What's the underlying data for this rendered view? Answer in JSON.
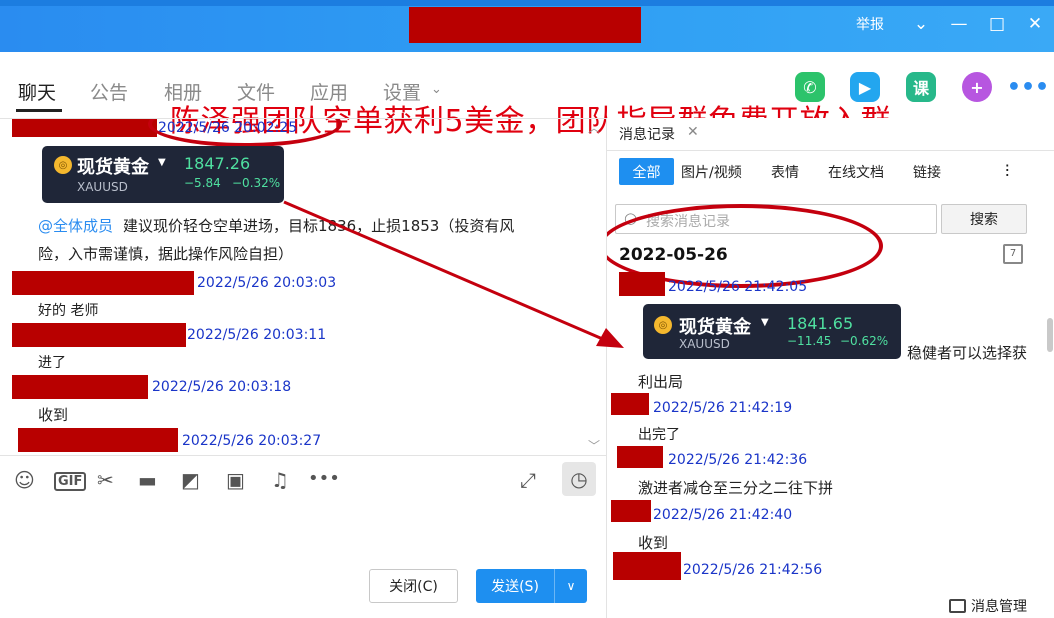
{
  "titlebar": {
    "report": "举报",
    "min": "—",
    "max": "□",
    "close": "✕",
    "dropdown": "⌄"
  },
  "banner": "陈泽强团队空单获利5美金，团队指导群免费开放入群",
  "tabs": [
    "聊天",
    "公告",
    "相册",
    "文件",
    "应用",
    "设置"
  ],
  "chat": {
    "first_ts": "2022/5/26 20:02:25",
    "card": {
      "name": "现货黄金",
      "code": "XAUUSD",
      "price": "1847.26",
      "change": "−5.84",
      "pct": "−0.32%"
    },
    "mention": "@全体成员",
    "advice_line1": "建议现价轻仓空单进场，目标1836，止损1853（投资有风",
    "advice_line2": "险，入市需谨慎，据此操作风险自担）",
    "messages": [
      {
        "ts": "2022/5/26 20:03:03",
        "text": "好的  老师"
      },
      {
        "ts": "2022/5/26 20:03:11",
        "text": "进了"
      },
      {
        "ts": "2022/5/26 20:03:18",
        "text": "收到"
      },
      {
        "ts": "2022/5/26 20:03:27",
        "text": ""
      }
    ]
  },
  "toolbar": {
    "close": "关闭(C)",
    "send": "发送(S)"
  },
  "panel": {
    "tab": "消息记录",
    "filters": [
      "全部",
      "图片/视频",
      "表情",
      "在线文档",
      "链接"
    ],
    "search_placeholder": "搜索消息记录",
    "search_button": "搜索",
    "date": "2022-05-26",
    "first_ts": "2022/5/26 21:42:05",
    "card": {
      "name": "现货黄金",
      "code": "XAUUSD",
      "price": "1841.65",
      "change": "−11.45",
      "pct": "−0.62%"
    },
    "card_tail": "稳健者可以选择获",
    "card_tail2": "利出局",
    "messages": [
      {
        "ts": "2022/5/26 21:42:19",
        "text": "出完了"
      },
      {
        "ts": "2022/5/26 21:42:36",
        "text": "激进者减仓至三分之二往下拼"
      },
      {
        "ts": "2022/5/26 21:42:40",
        "text": "收到"
      },
      {
        "ts": "2022/5/26 21:42:56",
        "text": ""
      }
    ],
    "manage": "消息管理"
  },
  "colors": {
    "accent": "#1e8ff0",
    "redact": "#b80000",
    "annotation": "#c4000e",
    "timestamp": "#1a35c8"
  }
}
